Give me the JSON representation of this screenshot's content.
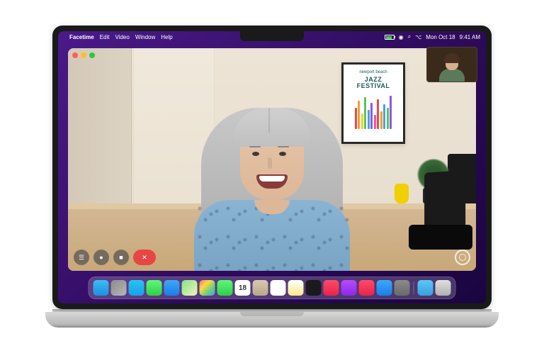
{
  "menubar": {
    "app_name": "Facetime",
    "menus": [
      "Edit",
      "Video",
      "Window",
      "Help"
    ],
    "status": {
      "date": "Mon Oct 18",
      "time": "9:41 AM"
    }
  },
  "poster": {
    "supertitle": "newport beach",
    "title_line1": "JAZZ",
    "title_line2": "FESTIVAL"
  },
  "call_controls": {
    "sidebar": "☰",
    "mute": "●",
    "camera": "■",
    "end": "✕"
  },
  "dock": {
    "icons": [
      {
        "name": "finder",
        "color": "linear-gradient(180deg,#3dbcf3,#1e8fe0)"
      },
      {
        "name": "launchpad",
        "color": "linear-gradient(135deg,#8a8a8a,#b8b8b8)"
      },
      {
        "name": "safari",
        "color": "linear-gradient(180deg,#26c5f3,#1a9ee8)"
      },
      {
        "name": "messages",
        "color": "linear-gradient(180deg,#5ef777,#2fd04a)"
      },
      {
        "name": "mail",
        "color": "linear-gradient(180deg,#3ea8f5,#1c7de8)"
      },
      {
        "name": "maps",
        "color": "linear-gradient(135deg,#7fe87f,#f5f0c0)"
      },
      {
        "name": "photos",
        "color": "linear-gradient(135deg,#ff6b8a,#ffd93d,#6bcf7f,#4d96ff)"
      },
      {
        "name": "facetime",
        "color": "linear-gradient(180deg,#5ef777,#2fd04a)"
      },
      {
        "name": "calendar",
        "color": "#fff"
      },
      {
        "name": "contacts",
        "color": "linear-gradient(180deg,#d8c8b0,#b8a888)"
      },
      {
        "name": "reminders",
        "color": "#fff"
      },
      {
        "name": "notes",
        "color": "linear-gradient(180deg,#fff,#ffe88a)"
      },
      {
        "name": "tv",
        "color": "#1a1a1a"
      },
      {
        "name": "music",
        "color": "linear-gradient(180deg,#ff4a6a,#e8234a)"
      },
      {
        "name": "podcasts",
        "color": "linear-gradient(180deg,#b84aff,#8a2ae8)"
      },
      {
        "name": "news",
        "color": "linear-gradient(180deg,#ff4a6a,#e8234a)"
      },
      {
        "name": "appstore",
        "color": "linear-gradient(180deg,#3ea8f5,#1c7de8)"
      },
      {
        "name": "settings",
        "color": "linear-gradient(180deg,#8a8a8a,#6a6a6a)"
      }
    ],
    "pinned": [
      {
        "name": "downloads",
        "color": "linear-gradient(180deg,#5ac8f5,#3a9ee0)"
      },
      {
        "name": "trash",
        "color": "linear-gradient(180deg,#e0e0e0,#b0b0b0)"
      }
    ]
  },
  "calendar_day": "18",
  "colors": {
    "desktop_purple": "#3a1a7a",
    "end_call_red": "#e84545"
  }
}
